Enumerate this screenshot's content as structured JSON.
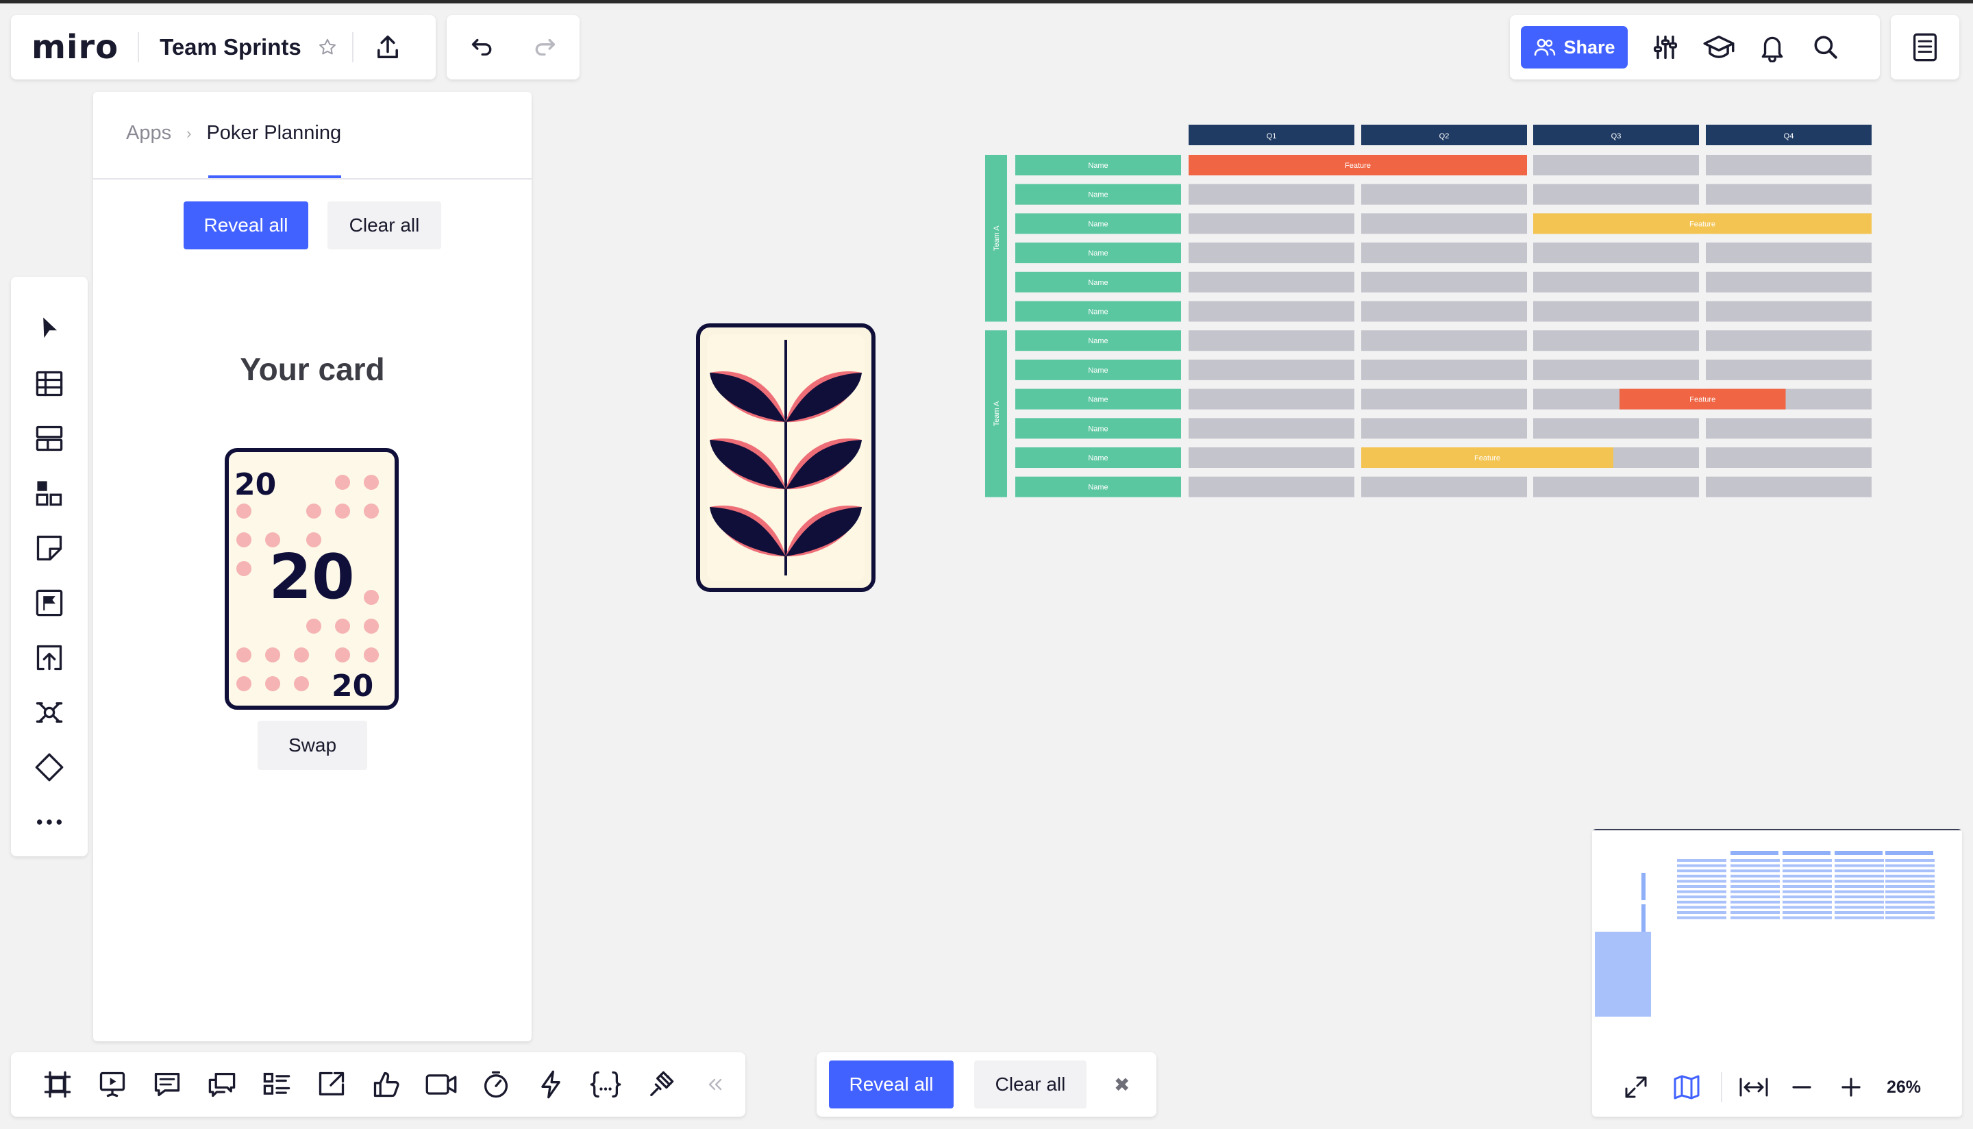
{
  "header": {
    "logo": "miro",
    "board_title": "Team Sprints",
    "share_label": "Share"
  },
  "app_panel": {
    "breadcrumb_root": "Apps",
    "breadcrumb_current": "Poker Planning",
    "reveal_label": "Reveal all",
    "clear_label": "Clear all",
    "heading": "Your card",
    "card_value": "20",
    "swap_label": "Swap"
  },
  "gantt": {
    "quarters": [
      "Q1",
      "Q2",
      "Q3",
      "Q4"
    ],
    "team_labels": [
      "Team A",
      "Team A"
    ],
    "row_label": "Name",
    "row_count": 12,
    "feature_label": "Feature",
    "features": [
      {
        "row": 0,
        "start": 0,
        "end": 2,
        "color": "#f06543"
      },
      {
        "row": 2,
        "start": 2,
        "end": 4,
        "color": "#f3c452"
      },
      {
        "row": 8,
        "start": 2.5,
        "end": 3.5,
        "color": "#f06543"
      },
      {
        "row": 10,
        "start": 1,
        "end": 2.5,
        "color": "#f3c452"
      }
    ],
    "colors": {
      "header": "#1f3b63",
      "name": "#5bc7a1",
      "cell": "#c4c4cc"
    }
  },
  "bottom_actions": {
    "reveal_label": "Reveal all",
    "clear_label": "Clear all",
    "close_symbol": "✖"
  },
  "minimap": {
    "zoom": "26%"
  },
  "colors": {
    "accent": "#4262ff",
    "card_border": "#0f0f3a",
    "card_dots": "#f5b3b3",
    "leaf_pink": "#ee6e78"
  },
  "icons": {
    "left_toolbar": [
      "select-icon",
      "table-icon",
      "template-icon",
      "shapes-icon",
      "sticky-note-icon",
      "frame-icon",
      "upload-icon",
      "mindmap-icon",
      "diamond-icon",
      "more-icon"
    ],
    "bottom_toolbar": [
      "frames-icon",
      "presentation-icon",
      "comments-icon",
      "chat-icon",
      "cards-icon",
      "share-screen-icon",
      "voting-icon",
      "video-icon",
      "timer-icon",
      "activity-icon",
      "code-icon",
      "apps-icon",
      "collapse-icon"
    ]
  }
}
